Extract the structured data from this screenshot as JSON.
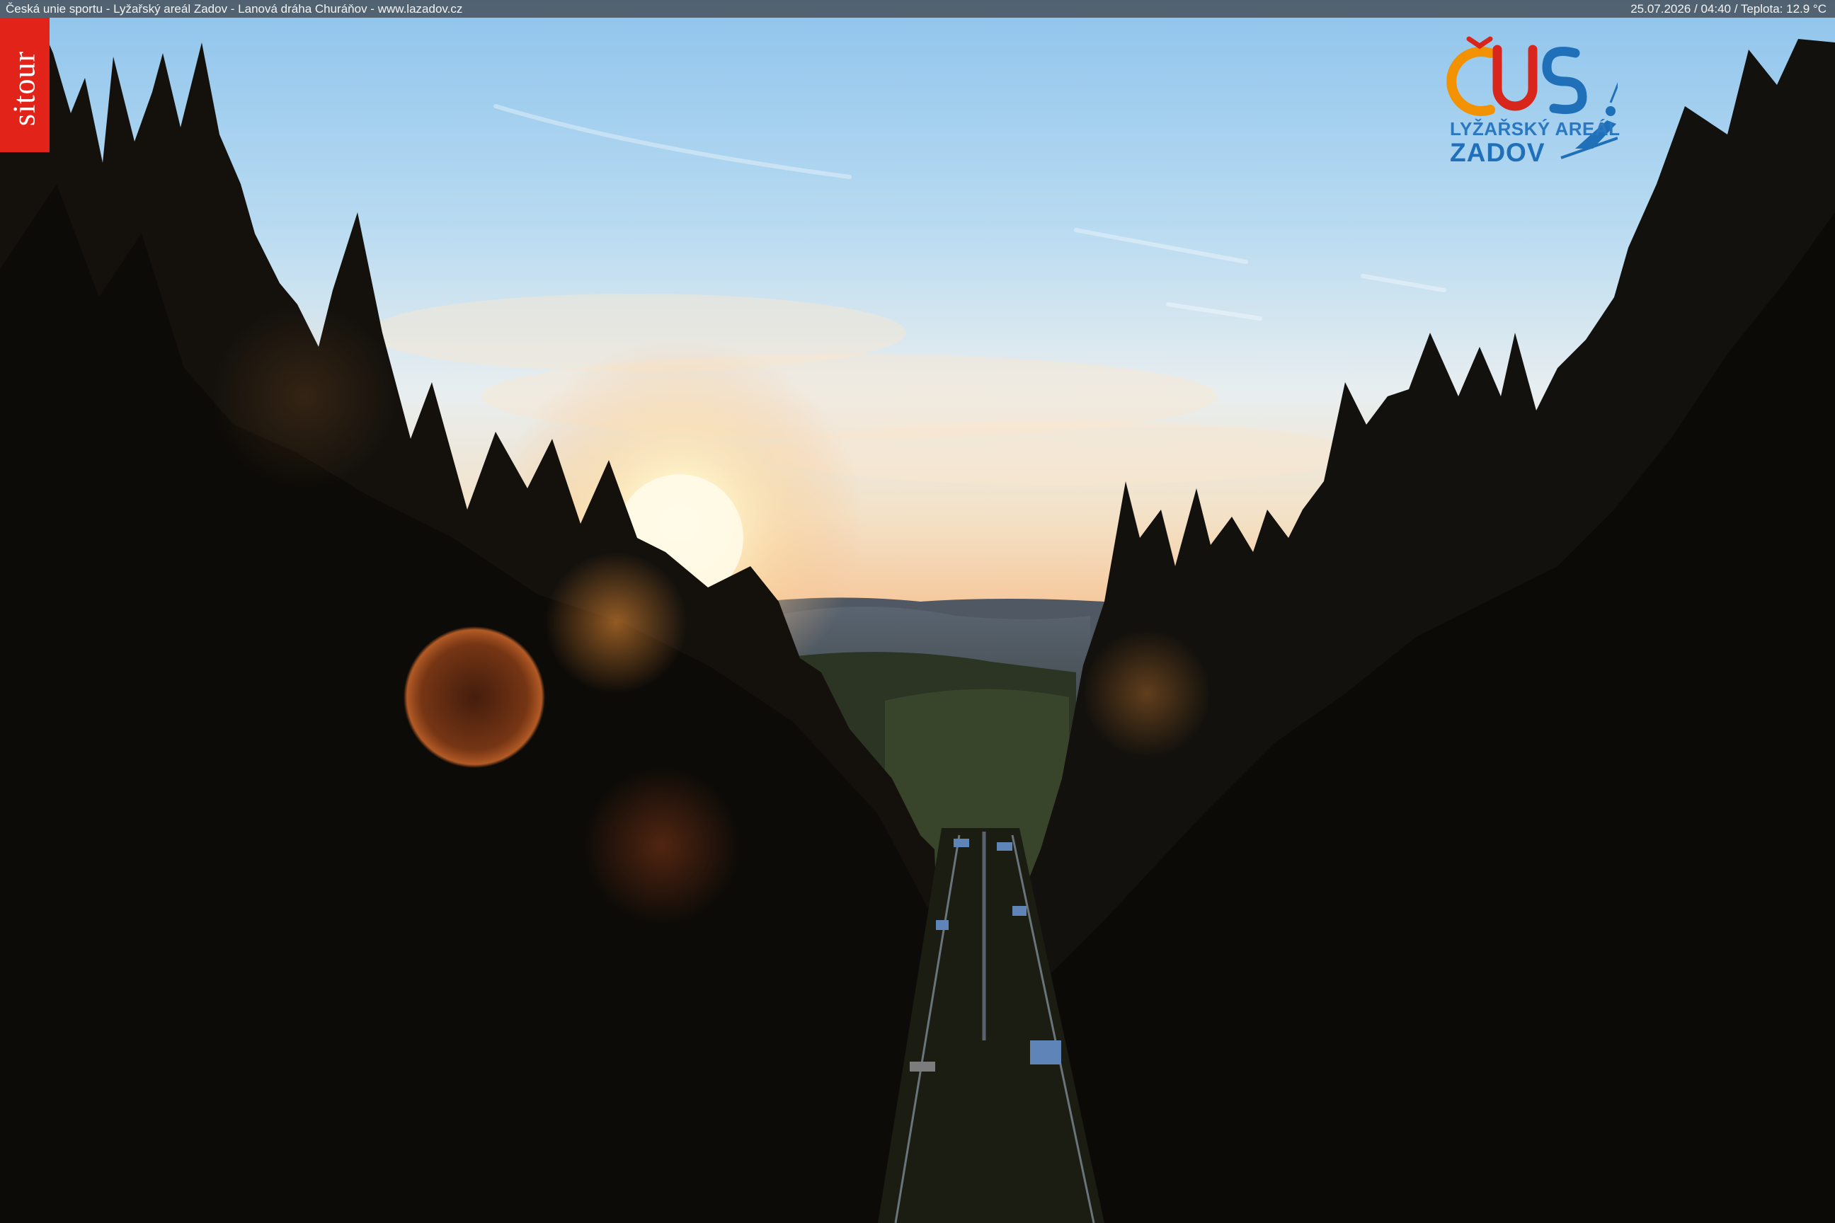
{
  "header": {
    "left_text": "Česká unie sportu - Lyžařský areál Zadov - Lanová dráha Churáňov - www.lazadov.cz",
    "right_text": "25.07.2026 / 04:40 / Teplota: 12.9 °C"
  },
  "badge": {
    "label": "sitour",
    "color": "#e2231a"
  },
  "logo": {
    "mark_text": "ČUS",
    "line1": "LYŽAŘSKÝ AREÁL",
    "line2": "ZADOV",
    "colors": {
      "orange": "#f39200",
      "blue": "#1f6fb9",
      "red": "#d9261c"
    }
  }
}
